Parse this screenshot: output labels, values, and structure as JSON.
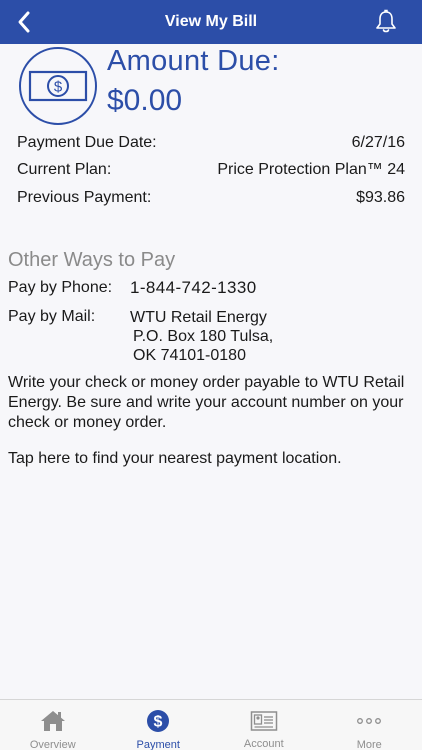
{
  "header": {
    "title": "View My Bill",
    "back_icon": "chevron-left-icon",
    "bell_icon": "bell-icon"
  },
  "amount": {
    "label": "Amount Due:",
    "value": "$0.00",
    "icon": "dollar-bill-icon"
  },
  "details": {
    "rows": [
      {
        "label": "Payment Due Date:",
        "value": "6/27/16"
      },
      {
        "label": "Current Plan:",
        "value": "Price Protection Plan™ 24"
      },
      {
        "label": "Previous Payment:",
        "value": "$93.86"
      }
    ]
  },
  "other_ways": {
    "title": "Other Ways to Pay",
    "phone_label": "Pay by Phone:",
    "phone_value": "1-844-742-1330",
    "mail_label": "Pay by Mail:",
    "mail_lines": [
      "WTU Retail Energy",
      "P.O. Box 180 Tulsa,",
      "OK 74101-0180"
    ],
    "instructions": "Write your check or money order payable to WTU Retail Energy. Be sure and write your account number on your check or money order.",
    "tap_text": "Tap here to find your nearest payment location."
  },
  "tabbar": {
    "tabs": [
      {
        "label": "Overview",
        "icon": "home-icon"
      },
      {
        "label": "Payment",
        "icon": "dollar-circle-icon"
      },
      {
        "label": "Account",
        "icon": "id-card-icon"
      },
      {
        "label": "More",
        "icon": "more-dots-icon"
      }
    ],
    "active_index": 1
  },
  "colors": {
    "primary": "#2c4ea8",
    "muted_text": "#8a8a8a",
    "inactive_tab": "#8e8e8e"
  }
}
